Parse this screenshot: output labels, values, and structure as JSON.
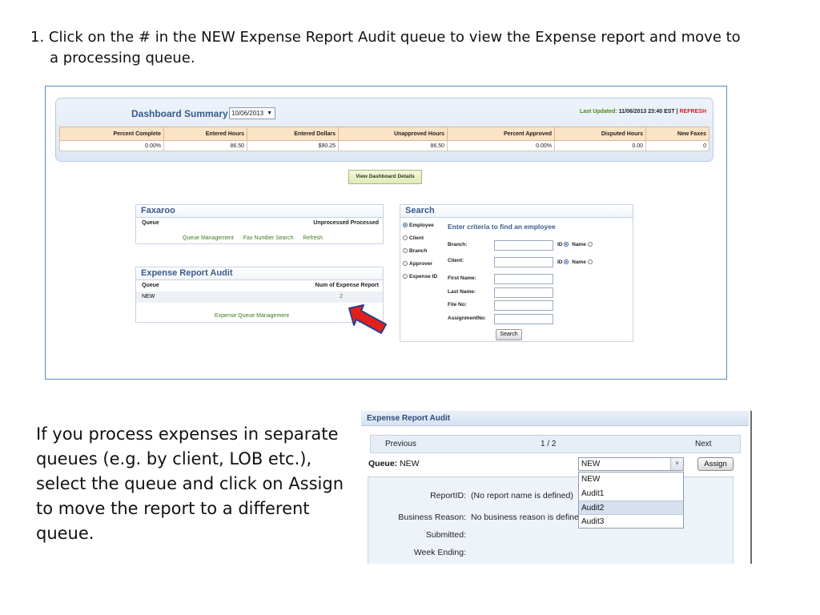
{
  "instruction": {
    "line1": "1. Click on the # in the NEW Expense Report Audit queue to view the Expense report and move to",
    "line2": "a processing queue."
  },
  "dashboard": {
    "title": "Dashboard Summary for",
    "date_value": "10/06/2013",
    "last_updated_label": "Last Updated:",
    "last_updated_value": "11/06/2013 23:40 EST |",
    "refresh_label": "REFRESH",
    "columns": [
      "Percent Complete",
      "Entered Hours",
      "Entered Dollars",
      "Unapproved Hours",
      "Percent Approved",
      "Disputed Hours",
      "New Faxes"
    ],
    "values": [
      "0.00%",
      "86.50",
      "$90.25",
      "86.50",
      "0.00%",
      "0.00",
      "0"
    ],
    "details_button": "View Dashboard Details"
  },
  "faxaroo": {
    "title": "Faxaroo",
    "col_queue": "Queue",
    "col_status": "Unprocessed Processed",
    "links": [
      "Queue Management",
      "Fax Number Search",
      "Refresh"
    ]
  },
  "expense_audit": {
    "title": "Expense Report Audit",
    "col_queue": "Queue",
    "col_num": "Num of Expense Report",
    "row_queue": "NEW",
    "row_count": "2",
    "mgmt_link": "Expense Queue Management"
  },
  "search": {
    "title": "Search",
    "heading": "Enter criteria to find an employee",
    "radios": [
      "Employee",
      "Client",
      "Branch",
      "Approver",
      "Expense ID"
    ],
    "selected_radio": "Employee",
    "fields": [
      "Branch:",
      "Client:",
      "First Name:",
      "Last Name:",
      "File No:",
      "AssignmentNo:"
    ],
    "id_label": "ID",
    "name_label": "Name",
    "button": "Search"
  },
  "note": "If you process expenses in separate queues (e.g. by client, LOB etc.), select the queue and click on Assign to move the report to a different queue.",
  "assign_panel": {
    "title": "Expense Report Audit",
    "prev": "Previous",
    "page": "1 / 2",
    "next": "Next",
    "queue_label": "Queue:",
    "queue_value": "NEW",
    "select_value": "NEW",
    "assign_button": "Assign",
    "options": [
      "NEW",
      "Audit1",
      "Audit2",
      "Audit3"
    ],
    "highlighted_option": "Audit2",
    "details": [
      {
        "label": "ReportID:",
        "value": "(No report name is defined)"
      },
      {
        "label": "Business Reason:",
        "value": "No business reason is define"
      },
      {
        "label": "Submitted:",
        "value": ""
      },
      {
        "label": "Week Ending:",
        "value": ""
      }
    ]
  },
  "colors": {
    "accent_blue": "#3a5a8c",
    "link_green": "#3b7a20",
    "header_peach": "#fbe3c5",
    "refresh_red": "#d0232a",
    "arrow_red": "#e0201a"
  }
}
